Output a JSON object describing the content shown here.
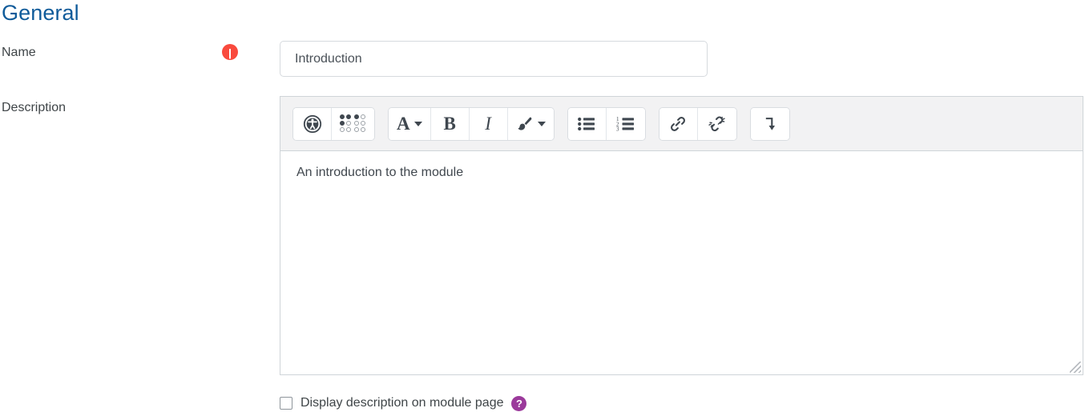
{
  "section": {
    "heading": "General"
  },
  "fields": {
    "name": {
      "label": "Name",
      "required_icon": "required-exclamation-icon",
      "value": "Introduction",
      "placeholder": ""
    },
    "description": {
      "label": "Description",
      "value": "An introduction to the module"
    }
  },
  "editor": {
    "toolbar_groups": [
      {
        "name": "accessibility-group",
        "buttons": [
          {
            "name": "accessibility-checker-button",
            "icon": "accessibility-person-icon",
            "label": ""
          },
          {
            "name": "screenreader-helper-button",
            "icon": "braille-dots-icon",
            "label": ""
          }
        ]
      },
      {
        "name": "text-style-group",
        "buttons": [
          {
            "name": "font-style-button",
            "icon": "letter-a-icon",
            "label": "A",
            "has_caret": true
          },
          {
            "name": "bold-button",
            "icon": "bold-icon",
            "label": "B",
            "has_caret": false
          },
          {
            "name": "italic-button",
            "icon": "italic-icon",
            "label": "I",
            "has_caret": false
          },
          {
            "name": "highlight-color-button",
            "icon": "paintbrush-icon",
            "label": "",
            "has_caret": true
          }
        ]
      },
      {
        "name": "list-group",
        "buttons": [
          {
            "name": "bullet-list-button",
            "icon": "bullet-list-icon",
            "label": ""
          },
          {
            "name": "numbered-list-button",
            "icon": "numbered-list-icon",
            "label": ""
          }
        ]
      },
      {
        "name": "link-group",
        "buttons": [
          {
            "name": "insert-link-button",
            "icon": "link-chain-icon",
            "label": ""
          },
          {
            "name": "remove-link-button",
            "icon": "broken-link-icon",
            "label": ""
          }
        ]
      },
      {
        "name": "expand-group",
        "buttons": [
          {
            "name": "show-more-buttons-button",
            "icon": "arrow-turn-down-icon",
            "label": ""
          }
        ]
      }
    ],
    "numbered_list_digits": [
      "1",
      "2",
      "3"
    ],
    "resize_handle": "resize-grip-icon"
  },
  "display_option": {
    "checked": false,
    "label": "Display description on module page",
    "help_icon": "help-question-icon",
    "help_glyph": "?"
  },
  "colors": {
    "heading": "#0f5b9a",
    "required": "#f94a3d",
    "help": "#9b3a9b",
    "text": "#3f4548",
    "toolbar_bg": "#f2f2f3",
    "border": "#cfd4d8"
  }
}
